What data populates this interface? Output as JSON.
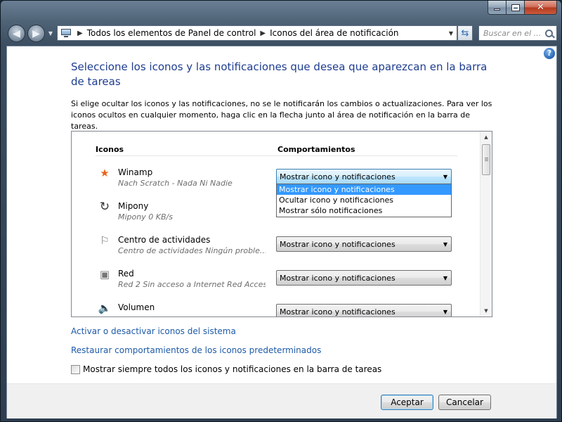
{
  "window": {
    "caption_buttons": {
      "minimize": "minimize-icon",
      "maximize": "maximize-icon",
      "close": "close-icon"
    }
  },
  "nav": {
    "back_icon": "back-arrow-icon",
    "forward_icon": "forward-arrow-icon",
    "breadcrumb": [
      "Todos los elementos de Panel de control",
      "Iconos del área de notificación"
    ],
    "search_placeholder": "Buscar en el ..."
  },
  "page": {
    "heading": "Seleccione los iconos y las notificaciones que desea que aparezcan en la barra de tareas",
    "description": "Si elige ocultar los iconos y las notificaciones, no se le notificarán los cambios o actualizaciones. Para ver los iconos ocultos en cualquier momento, haga clic en la flecha junto al área de notificación en la barra de tareas."
  },
  "table": {
    "col_icons": "Iconos",
    "col_behaviors": "Comportamientos",
    "rows": [
      {
        "icon": "winamp-star-icon",
        "name": "Winamp",
        "sub": "Nach Scratch - Nada Ni Nadie",
        "behavior": "Mostrar icono y notificaciones",
        "open": true
      },
      {
        "icon": "mipony-icon",
        "name": "Mipony",
        "sub": "Mipony 0 KB/s",
        "behavior": ""
      },
      {
        "icon": "action-center-flag-icon",
        "name": "Centro de actividades",
        "sub": "Centro de actividades  Ningún proble...",
        "behavior": "Mostrar icono y notificaciones"
      },
      {
        "icon": "network-icon",
        "name": "Red",
        "sub": "Red  2 Sin acceso a Internet Red Acces...",
        "behavior": "Mostrar icono y notificaciones"
      },
      {
        "icon": "speaker-icon",
        "name": "Volumen",
        "sub": "",
        "behavior": "Mostrar icono y notificaciones"
      }
    ],
    "dropdown_options": [
      "Mostrar icono y notificaciones",
      "Ocultar icono y notificaciones",
      "Mostrar sólo notificaciones"
    ]
  },
  "links": {
    "system_icons": "Activar o desactivar iconos del sistema",
    "restore_defaults": "Restaurar comportamientos de los iconos predeterminados"
  },
  "checkbox": {
    "label": "Mostrar siempre todos los iconos y notificaciones en la barra de tareas",
    "checked": false
  },
  "buttons": {
    "ok": "Aceptar",
    "cancel": "Cancelar"
  },
  "colors": {
    "heading": "#1e3d8f",
    "link": "#1e5aa8",
    "selection": "#3399ff"
  }
}
